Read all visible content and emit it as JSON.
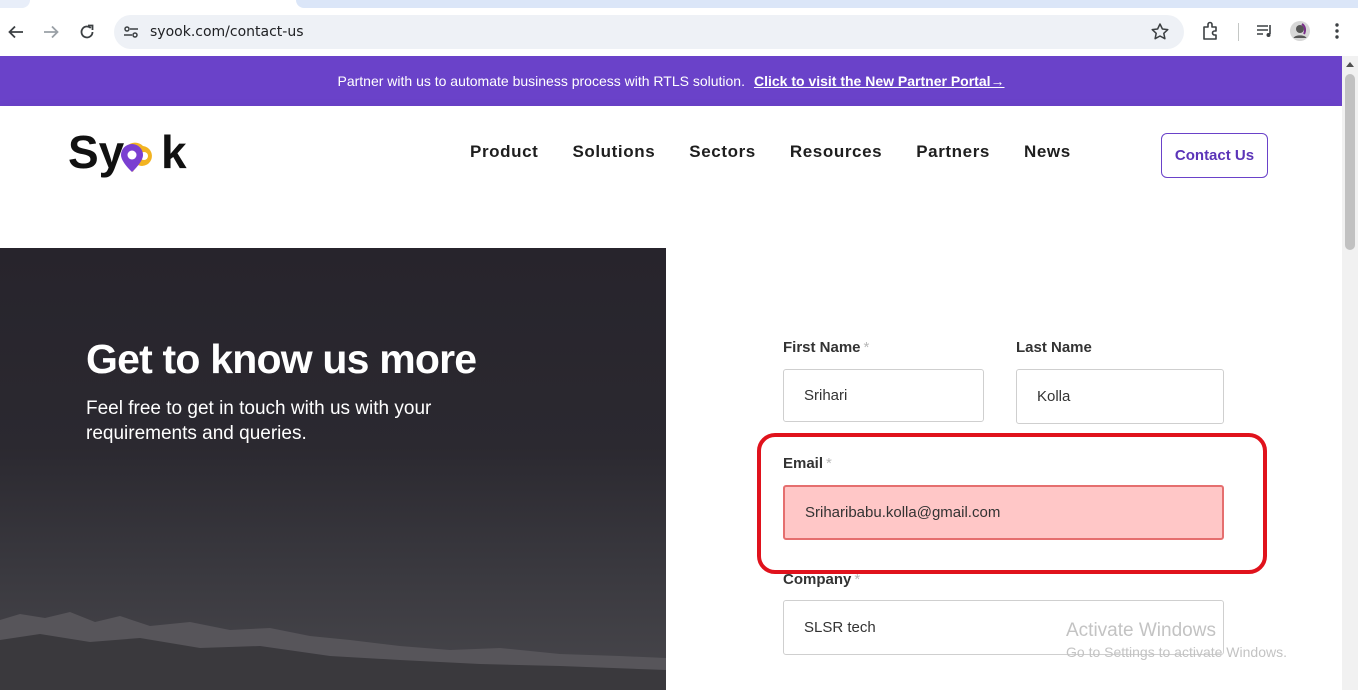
{
  "browser": {
    "url": "syook.com/contact-us"
  },
  "promo": {
    "text": "Partner with us to automate business process with RTLS solution.",
    "link": "Click to visit the New Partner Portal→"
  },
  "header": {
    "nav": [
      "Product",
      "Solutions",
      "Sectors",
      "Resources",
      "Partners",
      "News"
    ],
    "contact_button": "Contact Us"
  },
  "hero": {
    "title": "Get to know us more",
    "subtitle": "Feel free to get in touch with us with your requirements and queries."
  },
  "form": {
    "first_name": {
      "label": "First Name",
      "required": "*",
      "value": "Srihari"
    },
    "last_name": {
      "label": "Last Name",
      "value": "Kolla"
    },
    "email": {
      "label": "Email",
      "required": "*",
      "value": "Sriharibabu.kolla@gmail.com",
      "state": "error"
    },
    "company": {
      "label": "Company",
      "required": "*",
      "value": "SLSR tech"
    }
  },
  "watermark": {
    "line1": "Activate Windows",
    "line2": "Go to Settings to activate Windows."
  },
  "colors": {
    "brand_purple": "#6a42c9",
    "error_fill": "#ffc7c7",
    "highlight_red": "#e0121c"
  }
}
